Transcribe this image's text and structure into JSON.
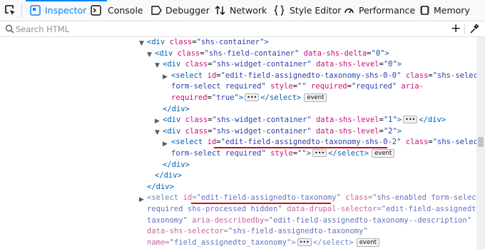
{
  "toolbar": {
    "tabs": [
      {
        "label": "Inspector",
        "icon": "inspector-icon"
      },
      {
        "label": "Console",
        "icon": "console-icon"
      },
      {
        "label": "Debugger",
        "icon": "debugger-icon"
      },
      {
        "label": "Network",
        "icon": "network-icon"
      },
      {
        "label": "Style Editor",
        "icon": "style-editor-icon"
      },
      {
        "label": "Performance",
        "icon": "performance-icon"
      },
      {
        "label": "Memory",
        "icon": "memory-icon"
      }
    ],
    "selected_tab": "Inspector",
    "accent_color": "#0a84ff"
  },
  "search": {
    "placeholder": "Search HTML",
    "value": "",
    "add_node": "+"
  },
  "markup": {
    "open_div": "<div",
    "close_div": "</div>",
    "gt": ">",
    "open_select": "<select",
    "close_select": "</select>",
    "eq": "=",
    "sp": " ",
    "attr_class": "class",
    "attr_id": "id",
    "attr_style": "style",
    "attr_required": "required",
    "attr_aria_required": "aria-",
    "attr_aria_required2": "required",
    "attr_delta": "data-shs-delta",
    "attr_level": "data-shs-level",
    "attr_drupal_sel": "data-drupal-selector",
    "attr_describedby": "aria-describedby",
    "attr_shs_sel": "data-shs-selector",
    "attr_name": "name",
    "v_shs_container": "\"shs-container\"",
    "v_field_container": "\"shs-field-container\"",
    "v_delta0": "\"0\"",
    "v_widget_container": "\"shs-widget-container\"",
    "v_level0": "\"0\"",
    "v_level1": "\"1\"",
    "v_level2": "\"2\"",
    "v_id_00": "\"edit-field-assignedto-taxonomy-shs-0-0\"",
    "v_select_class_a": "\"shs-select",
    "v_select_class_b": "form-select required\"",
    "v_empty": "\"\"",
    "v_required": "\"required\"",
    "v_true": "\"true\"",
    "v_id_02": "\"edit-field-assignedto-taxonomy-shs-0-2\"",
    "v_id_tax": "\"edit-field-assignedto-taxonomy\"",
    "v_enabled_a": "\"shs-enabled form-select",
    "v_enabled_b": "required shs-processed hidden\"",
    "v_drupal_a": "\"edit-field-assignedto-",
    "v_drupal_b": "taxonomy\"",
    "v_describedby": "\"edit-field-assignedto-taxonomy--description\"",
    "v_shs_sel": "\"shs-field-assignedto-taxonomy\"",
    "v_name": "\"field_assignedto_taxonomy\"",
    "dots": "•••",
    "event_badge": "event"
  },
  "highlight_color": "#d7001c"
}
